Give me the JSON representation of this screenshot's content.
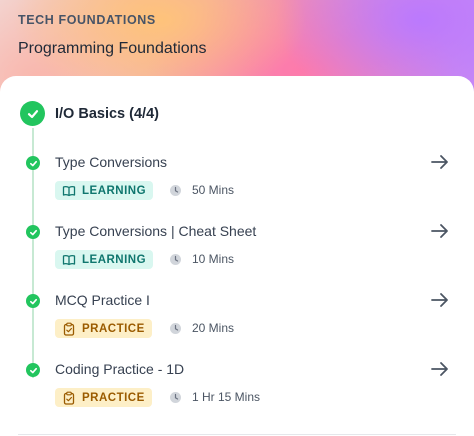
{
  "header": {
    "category": "TECH FOUNDATIONS",
    "course_title": "Programming Foundations"
  },
  "section": {
    "title": "I/O Basics (4/4)",
    "status": "completed"
  },
  "items": [
    {
      "title": "Type Conversions",
      "badge": "LEARNING",
      "badge_type": "learning",
      "duration": "50 Mins",
      "status": "completed"
    },
    {
      "title": "Type Conversions | Cheat Sheet",
      "badge": "LEARNING",
      "badge_type": "learning",
      "duration": "10 Mins",
      "status": "completed"
    },
    {
      "title": "MCQ Practice I",
      "badge": "PRACTICE",
      "badge_type": "practice",
      "duration": "20 Mins",
      "status": "completed"
    },
    {
      "title": "Coding Practice - 1D",
      "badge": "PRACTICE",
      "badge_type": "practice",
      "duration": "1 Hr 15 Mins",
      "status": "completed"
    }
  ],
  "icons": {
    "check": "check-icon",
    "arrow": "arrow-right-icon",
    "learning": "book-icon",
    "practice": "clipboard-icon",
    "clock": "clock-icon"
  },
  "colors": {
    "complete_green": "#22c55e",
    "learning_bg": "#d9f7f0",
    "learning_fg": "#0f766e",
    "practice_bg": "#fdefc7",
    "practice_fg": "#9a5b00"
  }
}
